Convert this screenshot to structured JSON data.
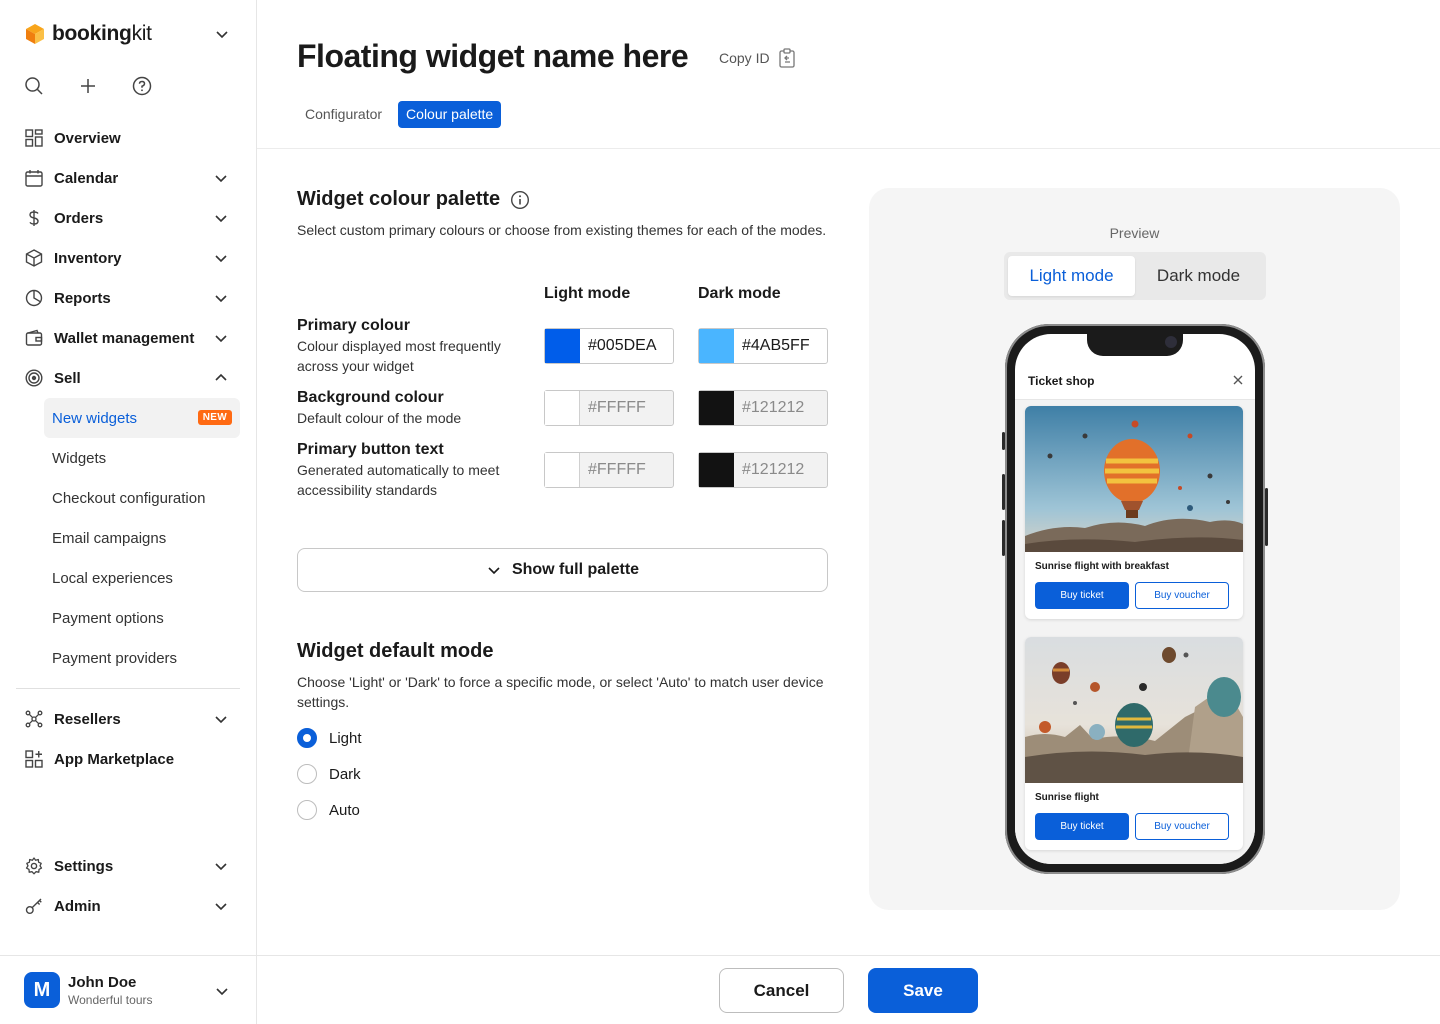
{
  "brand": {
    "name_bold": "booking",
    "name_light": "kit",
    "accent": "#F8A51B"
  },
  "sidebar": {
    "items": [
      {
        "label": "Overview",
        "icon": "grid-icon"
      },
      {
        "label": "Calendar",
        "icon": "calendar-icon"
      },
      {
        "label": "Orders",
        "icon": "dollar-icon"
      },
      {
        "label": "Inventory",
        "icon": "box-icon"
      },
      {
        "label": "Reports",
        "icon": "pie-chart-icon"
      },
      {
        "label": "Wallet management",
        "icon": "wallet-icon"
      },
      {
        "label": "Sell",
        "icon": "target-icon"
      }
    ],
    "sell_sub": [
      {
        "label": "New widgets",
        "badge": "NEW"
      },
      {
        "label": "Widgets"
      },
      {
        "label": "Checkout configuration"
      },
      {
        "label": "Email campaigns"
      },
      {
        "label": "Local experiences"
      },
      {
        "label": "Payment options"
      },
      {
        "label": "Payment providers"
      }
    ],
    "more": [
      {
        "label": "Resellers",
        "icon": "network-icon"
      },
      {
        "label": "App Marketplace",
        "icon": "apps-icon"
      }
    ],
    "bottom": [
      {
        "label": "Settings",
        "icon": "gear-icon"
      },
      {
        "label": "Admin",
        "icon": "key-icon"
      }
    ]
  },
  "user": {
    "initial": "M",
    "name": "John Doe",
    "org": "Wonderful tours"
  },
  "header": {
    "title": "Floating widget name here",
    "copy_id": "Copy ID",
    "tabs": [
      {
        "label": "Configurator"
      },
      {
        "label": "Colour palette",
        "active": true
      }
    ]
  },
  "palette": {
    "title": "Widget colour palette",
    "desc": "Select custom primary colours or choose from existing themes for each of the modes.",
    "col_light": "Light mode",
    "col_dark": "Dark mode",
    "rows": [
      {
        "title": "Primary colour",
        "desc": "Colour displayed most frequently across your widget",
        "light": "#005DEA",
        "dark": "#4AB5FF",
        "light_swatch": "#005DEA",
        "dark_swatch": "#4AB5FF"
      },
      {
        "title": "Background colour",
        "desc": "Default colour of the mode",
        "light": "#FFFFF",
        "dark": "#121212",
        "light_swatch": "#FFFFFF",
        "dark_swatch": "#121212"
      },
      {
        "title": "Primary button text",
        "desc": "Generated automatically to meet accessibility standards",
        "light": "#FFFFF",
        "dark": "#121212",
        "light_swatch": "#FFFFFF",
        "dark_swatch": "#121212"
      }
    ],
    "show_full": "Show full palette"
  },
  "default_mode": {
    "title": "Widget default mode",
    "desc": "Choose 'Light' or 'Dark' to force a specific mode, or select 'Auto' to match user device settings.",
    "options": [
      {
        "label": "Light",
        "checked": true
      },
      {
        "label": "Dark"
      },
      {
        "label": "Auto"
      }
    ]
  },
  "preview": {
    "label": "Preview",
    "modes": [
      {
        "label": "Light mode",
        "active": true
      },
      {
        "label": "Dark mode"
      }
    ],
    "shop_title": "Ticket shop",
    "cards": [
      {
        "title": "Sunrise flight with breakfast",
        "buy": "Buy ticket",
        "voucher": "Buy voucher"
      },
      {
        "title": "Sunrise flight",
        "buy": "Buy ticket",
        "voucher": "Buy voucher"
      }
    ]
  },
  "footer": {
    "cancel": "Cancel",
    "save": "Save"
  },
  "colors": {
    "primary": "#0A5FD9",
    "badge": "#FF6A13"
  }
}
